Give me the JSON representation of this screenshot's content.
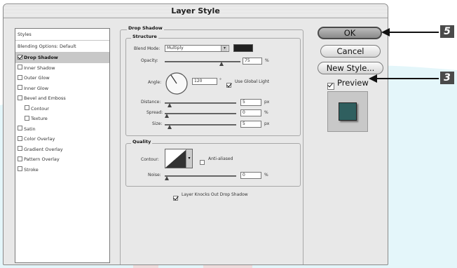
{
  "dialog": {
    "title": "Layer Style"
  },
  "left_panel": {
    "items": [
      {
        "label": "Styles",
        "checkbox": false,
        "indent": false,
        "selected": false,
        "checked": false
      },
      {
        "label": "Blending Options: Default",
        "checkbox": false,
        "indent": false,
        "selected": false,
        "checked": false
      },
      {
        "label": "Drop Shadow",
        "checkbox": true,
        "indent": false,
        "selected": true,
        "checked": true
      },
      {
        "label": "Inner Shadow",
        "checkbox": true,
        "indent": false,
        "selected": false,
        "checked": false
      },
      {
        "label": "Outer Glow",
        "checkbox": true,
        "indent": false,
        "selected": false,
        "checked": false
      },
      {
        "label": "Inner Glow",
        "checkbox": true,
        "indent": false,
        "selected": false,
        "checked": false
      },
      {
        "label": "Bevel and Emboss",
        "checkbox": true,
        "indent": false,
        "selected": false,
        "checked": false
      },
      {
        "label": "Contour",
        "checkbox": true,
        "indent": true,
        "selected": false,
        "checked": false
      },
      {
        "label": "Texture",
        "checkbox": true,
        "indent": true,
        "selected": false,
        "checked": false
      },
      {
        "label": "Satin",
        "checkbox": true,
        "indent": false,
        "selected": false,
        "checked": false
      },
      {
        "label": "Color Overlay",
        "checkbox": true,
        "indent": false,
        "selected": false,
        "checked": false
      },
      {
        "label": "Gradient Overlay",
        "checkbox": true,
        "indent": false,
        "selected": false,
        "checked": false
      },
      {
        "label": "Pattern Overlay",
        "checkbox": true,
        "indent": false,
        "selected": false,
        "checked": false
      },
      {
        "label": "Stroke",
        "checkbox": true,
        "indent": false,
        "selected": false,
        "checked": false
      }
    ]
  },
  "drop_shadow": {
    "title": "Drop Shadow",
    "structure": {
      "title": "Structure",
      "blend_mode_label": "Blend Mode:",
      "blend_mode_value": "Multiply",
      "shadow_color": "#202020",
      "opacity_label": "Opacity:",
      "opacity_value": "75",
      "opacity_unit": "%",
      "opacity_level": 0.75,
      "angle_label": "Angle:",
      "angle_value": "120",
      "angle_unit": "°",
      "global_light_label": "Use Global Light",
      "global_light_checked": true,
      "distance_label": "Distance:",
      "distance_value": "5",
      "distance_unit": "px",
      "spread_label": "Spread:",
      "spread_value": "0",
      "spread_unit": "%",
      "size_label": "Size:",
      "size_value": "5",
      "size_unit": "px"
    },
    "quality": {
      "title": "Quality",
      "contour_label": "Contour:",
      "anti_aliased_label": "Anti-aliased",
      "noise_label": "Noise:",
      "noise_value": "0",
      "noise_unit": "%"
    },
    "knockout_label": "Layer Knocks Out Drop Shadow"
  },
  "buttons": {
    "ok": "OK",
    "cancel": "Cancel",
    "new_style": "New Style...",
    "preview_label": "Preview",
    "preview_checked": true
  },
  "callouts": {
    "step_5": "5",
    "step_3": "3"
  },
  "colors": {
    "preview_swatch": "#2f5f5f",
    "background_cyan": "#cdeef5",
    "background_red": "#f1d3d0"
  }
}
